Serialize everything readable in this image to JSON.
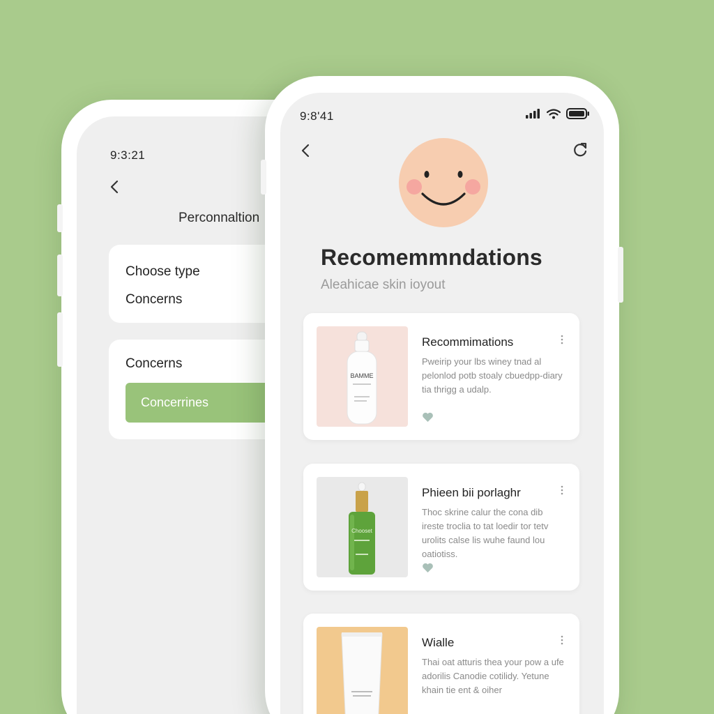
{
  "back_screen": {
    "time": "9:3:21",
    "title": "Perconnaltion",
    "card_choose": {
      "line1": "Choose type",
      "line2": "Concerns"
    },
    "card_concerns": {
      "label": "Concerns",
      "pill": "Concerrines"
    }
  },
  "front_screen": {
    "time": "9:8'41",
    "title": "Recomemmndations",
    "subtitle": "Aleahicae skin ioyout",
    "products": [
      {
        "title": "Recommimations",
        "description": "Pweirip your lbs winey tnad al pelonlod potb stoaly cbuedpp-diary tia thrigg a udalp.",
        "image_label": "BAMME"
      },
      {
        "title": "Phieen bii porlaghr",
        "description": "Thoc skrine calur the cona dib ireste troclia to tat loedir tor tetv urolits calse lis wuhe faund lou oatiotiss.",
        "image_label": "Chooset"
      },
      {
        "title": "Wialle",
        "description": "Thai oat atturis thea your pow a ufe adorilis Canodie cotilidy. Yetune khain tie ent & oiher",
        "image_label": ""
      }
    ]
  },
  "colors": {
    "background": "#a9cb8c",
    "accent_green": "#99c37a",
    "face": "#f7cdb0",
    "cheek": "#f5a7a0",
    "heart": "#a9c0b8"
  },
  "icons": [
    "chevron-left-icon",
    "refresh-icon",
    "signal-icon",
    "wifi-icon",
    "battery-icon",
    "more-vertical-icon",
    "heart-icon",
    "smiley-face-avatar"
  ]
}
